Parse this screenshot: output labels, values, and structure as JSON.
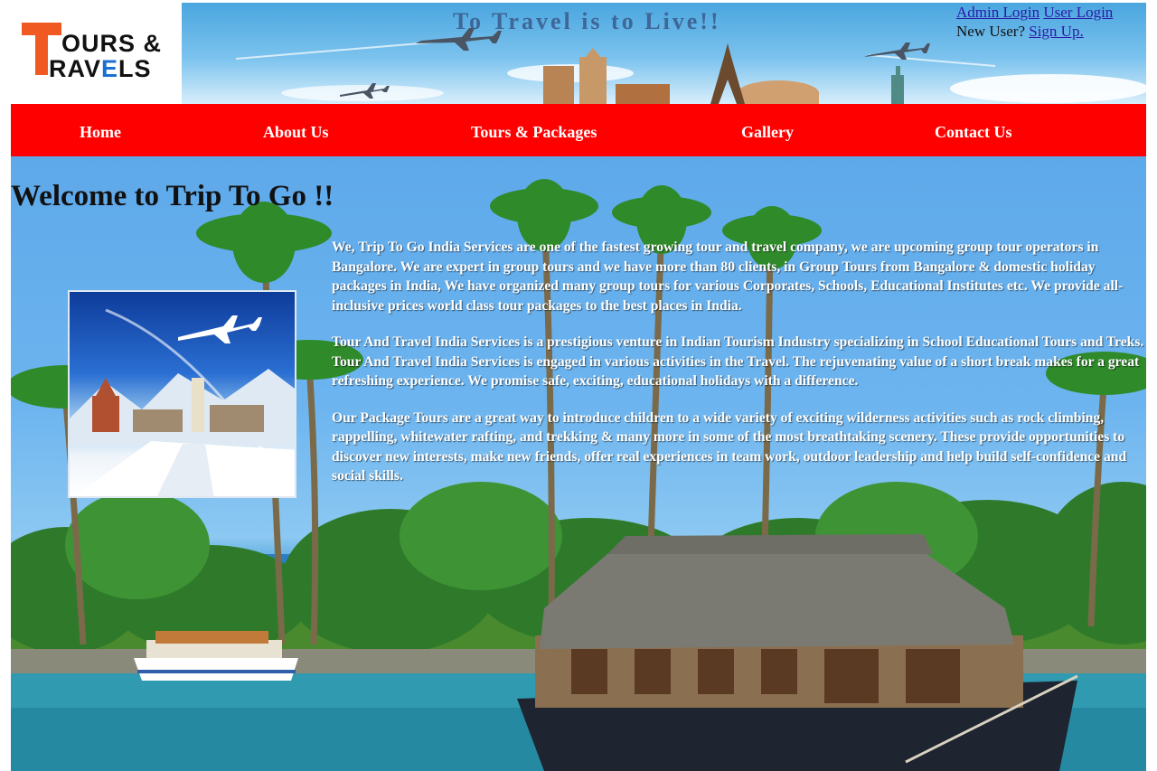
{
  "logo": {
    "line1": "OURS &",
    "line2_pre": "RAV",
    "line2_mid": "E",
    "line2_post": "LS"
  },
  "banner": {
    "tagline": "To Travel is to Live!!"
  },
  "auth": {
    "admin_login": "Admin Login",
    "user_login": "User Login",
    "new_user_prompt": "New User?",
    "sign_up": "Sign Up."
  },
  "nav": {
    "items": [
      {
        "label": "Home"
      },
      {
        "label": "About Us"
      },
      {
        "label": "Tours & Packages"
      },
      {
        "label": "Gallery"
      },
      {
        "label": "Contact Us"
      }
    ]
  },
  "main": {
    "heading": "Welcome to Trip To Go !!",
    "paragraphs": [
      "We, Trip To Go India Services are one of the fastest growing tour and travel company, we are upcoming group tour operators in Bangalore. We are expert in group tours and we have more than 80 clients, in Group Tours from Bangalore & domestic holiday packages in India, We have organized many group tours for various Corporates, Schools, Educational Institutes etc. We provide all-inclusive prices world class tour packages to the best places in India.",
      "Tour And Travel India Services is a prestigious venture in Indian Tourism Industry specializing in School Educational Tours and Treks. Tour And Travel India Services is engaged in various activities in the Travel. The rejuvenating value of a short break makes for a great refreshing experience. We promise safe, exciting, educational holidays with a difference.",
      "Our Package Tours are a great way to introduce children to a wide variety of exciting wilderness activities such as rock climbing, rappelling, whitewater rafting, and trekking & many more in some of the most breathtaking scenery. These provide opportunities to discover new interests, make new friends, offer real experiences in team work, outdoor leadership and help build self-confidence and social skills."
    ]
  },
  "colors": {
    "nav_bg": "#ff0000",
    "logo_accent": "#f05a22",
    "link": "#2a1aa6"
  }
}
